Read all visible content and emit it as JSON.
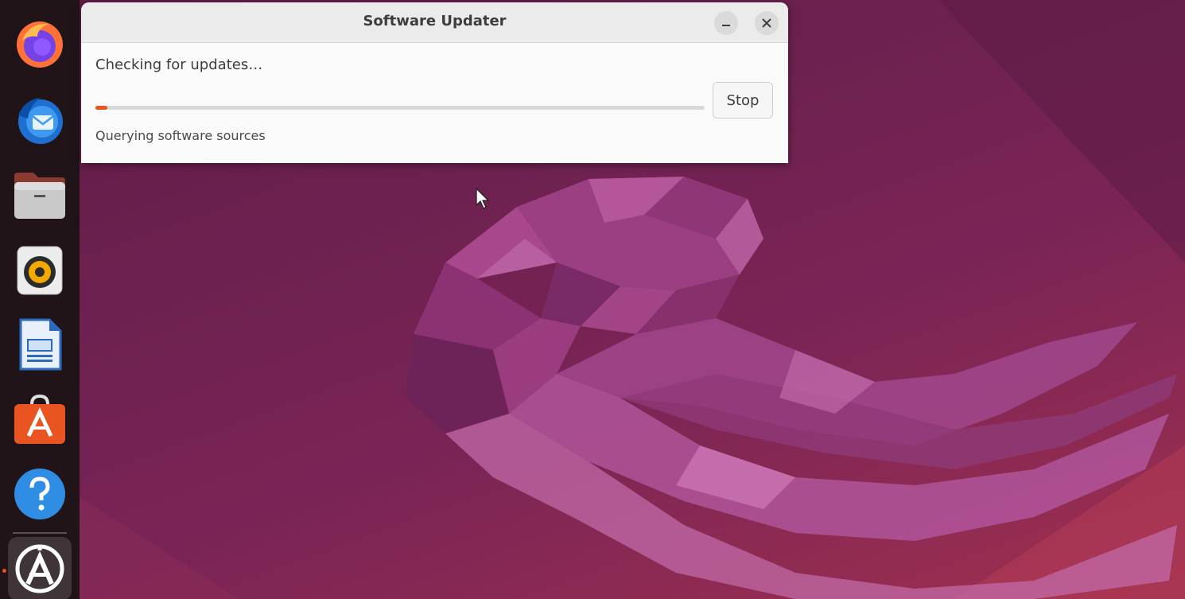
{
  "window": {
    "title": "Software Updater",
    "minimize_icon": "minimize-icon",
    "close_icon": "close-icon"
  },
  "updater": {
    "heading": "Checking for updates…",
    "detail": "Querying software sources",
    "progress": 0.02,
    "stop_label": "Stop"
  },
  "dock": {
    "items": [
      {
        "name": "firefox-icon",
        "running": false
      },
      {
        "name": "thunderbird-icon",
        "running": false
      },
      {
        "name": "files-icon",
        "running": false
      },
      {
        "name": "rhythmbox-icon",
        "running": false
      },
      {
        "name": "libreoffice-writer-icon",
        "running": false
      },
      {
        "name": "ubuntu-software-icon",
        "running": false
      },
      {
        "name": "help-icon",
        "running": false
      },
      {
        "name": "software-updater-icon",
        "running": true
      }
    ]
  },
  "colors": {
    "accent": "#e95420",
    "wallpaper": "#6e2150",
    "dock": "#201418"
  }
}
